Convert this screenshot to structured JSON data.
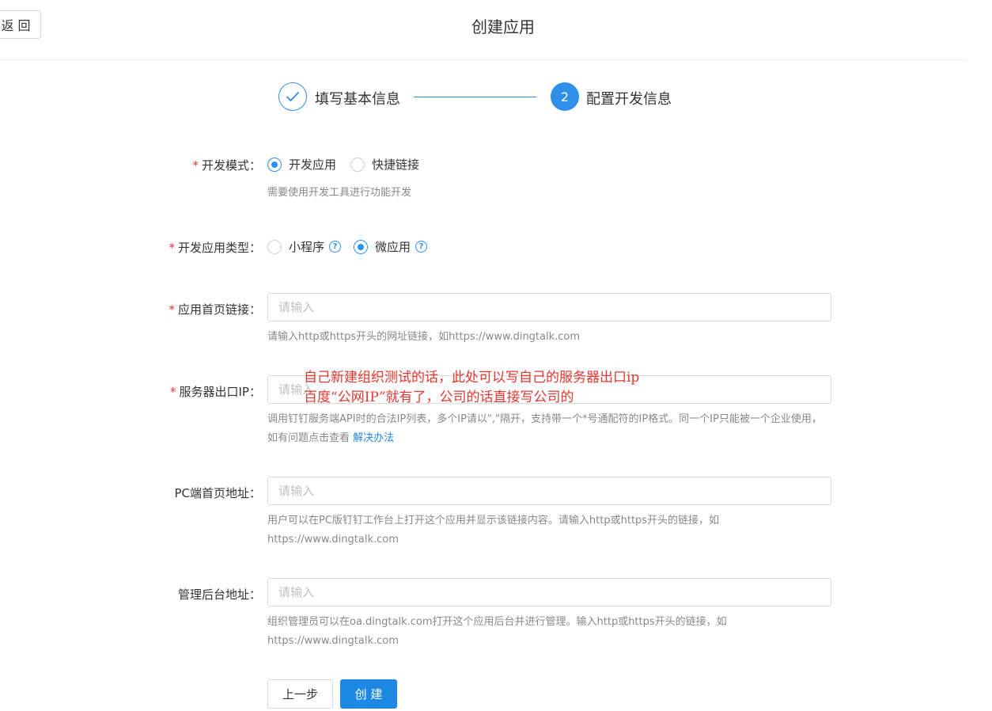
{
  "header": {
    "back_label": "返 回",
    "title": "创建应用"
  },
  "steps": [
    {
      "label": "填写基本信息",
      "status": "done",
      "icon": "check-icon"
    },
    {
      "label": "配置开发信息",
      "status": "active",
      "number": "2"
    }
  ],
  "form": {
    "dev_mode": {
      "label": "开发模式",
      "required": true,
      "options": [
        "开发应用",
        "快捷链接"
      ],
      "selected": "开发应用",
      "hint": "需要使用开发工具进行功能开发"
    },
    "app_type": {
      "label": "开发应用类型",
      "required": true,
      "options": [
        "小程序",
        "微应用"
      ],
      "selected": "微应用"
    },
    "homepage_url": {
      "label": "应用首页链接",
      "required": true,
      "placeholder": "请输入",
      "value": "",
      "hint": "请输入http或https开头的网址链接，如https://www.dingtalk.com"
    },
    "server_ip": {
      "label": "服务器出口IP",
      "required": true,
      "placeholder": "请输入",
      "value": "",
      "hint": "调用钉钉服务端API时的合法IP列表，多个IP请以\",\"隔开，支持带一个*号通配符的IP格式。同一个IP只能被一个企业使用，如有问题点击查看",
      "hint_link": "解决办法"
    },
    "pc_homepage": {
      "label": "PC端首页地址",
      "required": false,
      "placeholder": "请输入",
      "value": "",
      "hint": "用户可以在PC版钉钉工作台上打开这个应用并显示该链接内容。请输入http或https开头的链接，如https://www.dingtalk.com"
    },
    "admin_url": {
      "label": "管理后台地址",
      "required": false,
      "placeholder": "请输入",
      "value": "",
      "hint": "组织管理员可以在oa.dingtalk.com打开这个应用后台并进行管理。输入http或https开头的链接，如https://www.dingtalk.com"
    },
    "colon": "："
  },
  "annotation": {
    "line1": "自己新建组织测试的话，此处可以写自己的服务器出口ip",
    "line2": "百度“公网IP”就有了，公司的话直接写公司的"
  },
  "actions": {
    "prev_label": "上一步",
    "create_label": "创 建"
  },
  "colors": {
    "primary": "#1e88e5",
    "required": "#e8362f",
    "annotation": "#e8362f"
  }
}
